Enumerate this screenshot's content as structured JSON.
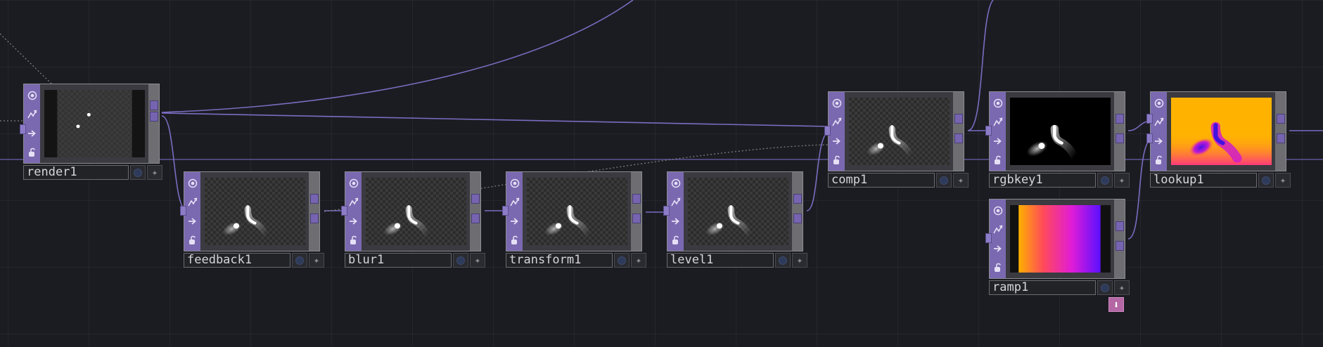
{
  "network": {
    "background_color": "#1b1c21",
    "wire_color": "#7b6cc2",
    "node_color": "#7a69b0",
    "viewer_buttons": [
      "viewer-icon",
      "bypass-icon",
      "display-icon",
      "lock-icon"
    ],
    "nodes": [
      {
        "id": "render1",
        "label": "render1",
        "preview": "render"
      },
      {
        "id": "feedback1",
        "label": "feedback1",
        "preview": "trails"
      },
      {
        "id": "blur1",
        "label": "blur1",
        "preview": "trails"
      },
      {
        "id": "transform1",
        "label": "transform1",
        "preview": "trails"
      },
      {
        "id": "level1",
        "label": "level1",
        "preview": "trails"
      },
      {
        "id": "comp1",
        "label": "comp1",
        "preview": "trails"
      },
      {
        "id": "rgbkey1",
        "label": "rgbkey1",
        "preview": "key"
      },
      {
        "id": "lookup1",
        "label": "lookup1",
        "preview": "lookup"
      },
      {
        "id": "ramp1",
        "label": "ramp1",
        "preview": "ramp"
      }
    ],
    "ramp_extra_button_icon": "arrow-down-icon",
    "ramp_extra_button_glyph": "🡇",
    "star_glyph": "✦"
  }
}
